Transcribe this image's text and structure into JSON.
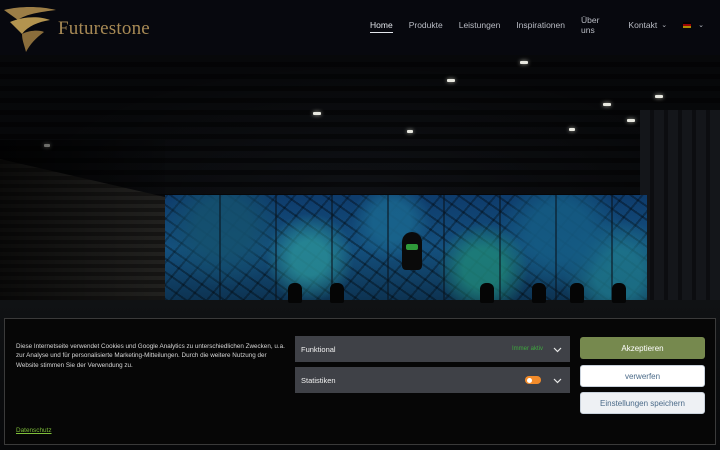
{
  "brand": {
    "name": "Futurestone",
    "logo_icon": "gold-swirl-logo-icon"
  },
  "nav": {
    "items": [
      {
        "label": "Home",
        "active": true
      },
      {
        "label": "Produkte",
        "active": false
      },
      {
        "label": "Leistungen",
        "active": false
      },
      {
        "label": "Inspirationen",
        "active": false
      },
      {
        "label": "Über uns",
        "active": false
      },
      {
        "label": "Kontakt",
        "active": false,
        "has_dropdown": true
      }
    ],
    "language_icon": "german-flag-icon"
  },
  "cookie_banner": {
    "text": "Diese Internetseite verwendet Cookies und Google Analytics zu unterschiedlichen Zwecken, u.a. zur Analyse und für personalisierte Marketing-Mitteilungen. Durch die weitere Nutzung der Website stimmen Sie der Verwendung zu.",
    "privacy_link": "Datenschutz",
    "preferences": [
      {
        "label": "Funktional",
        "status": "Immer aktiv"
      },
      {
        "label": "Statistiken",
        "toggle_color": "#f28b2a"
      }
    ],
    "buttons": {
      "accept": "Akzeptieren",
      "deny": "verwerfen",
      "save": "Einstellungen speichern"
    },
    "colors": {
      "accept_bg": "#76894e",
      "link": "#7fbf3a",
      "status_green": "#3ea83e"
    }
  }
}
